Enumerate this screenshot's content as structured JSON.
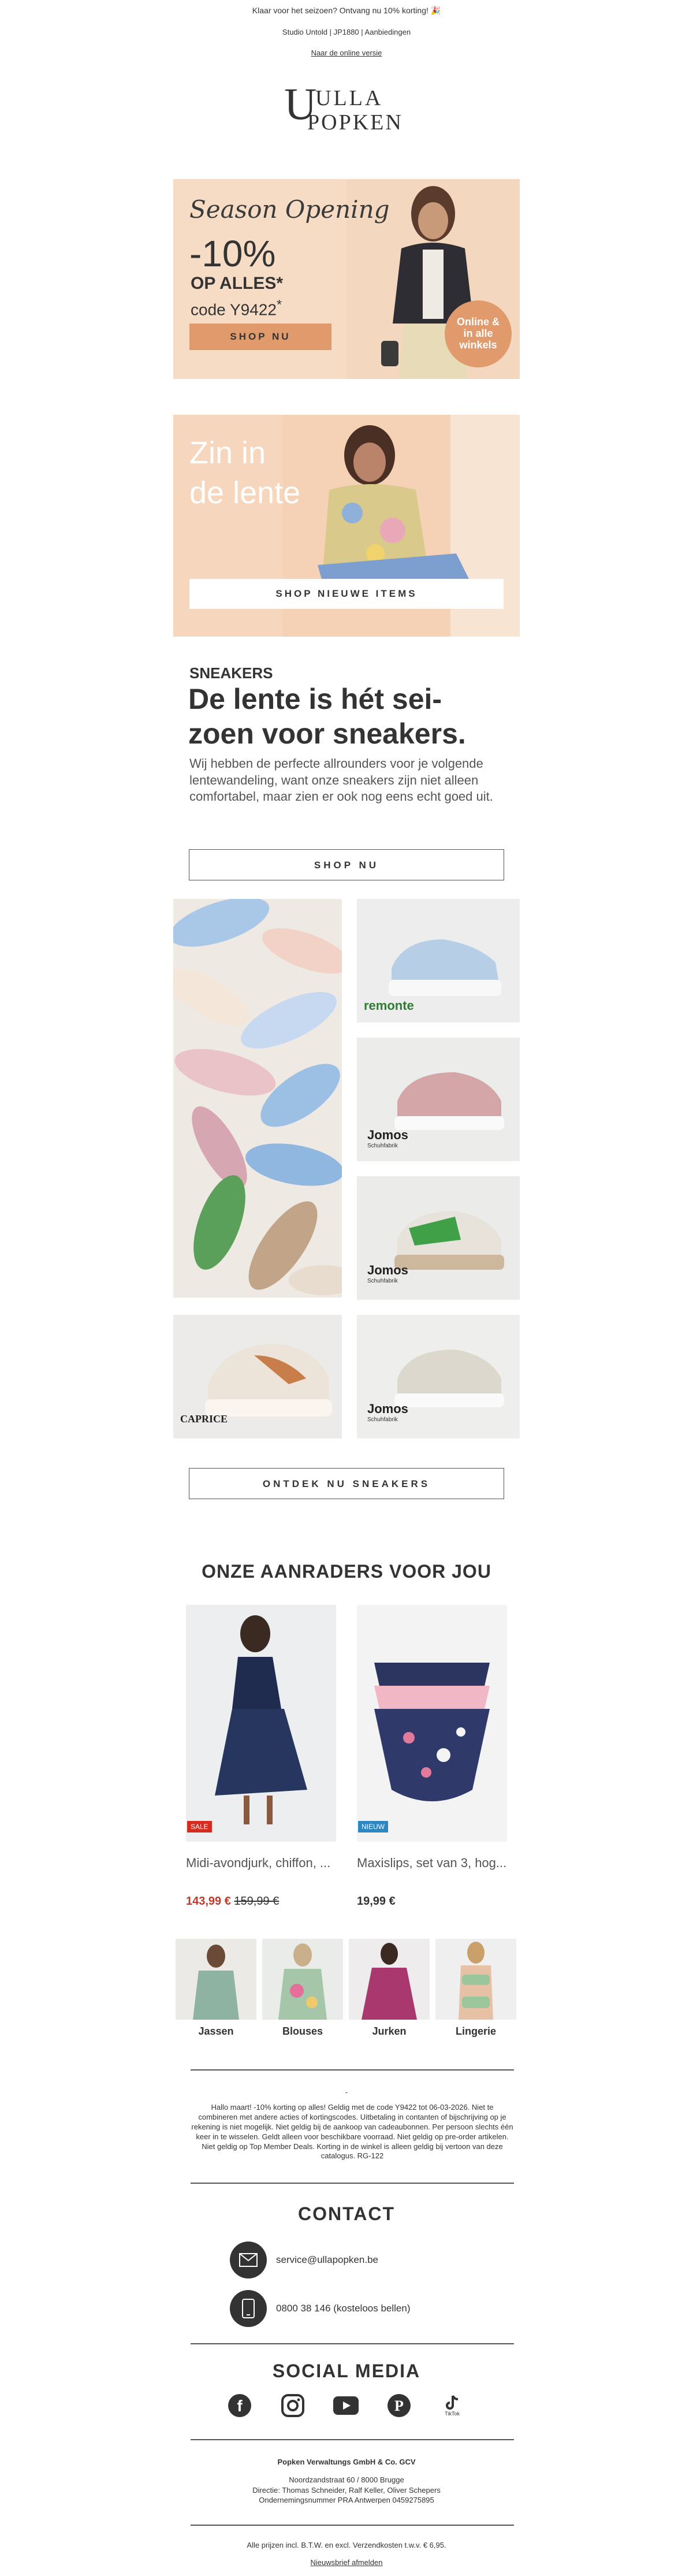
{
  "header": {
    "preheader": "Klaar voor het seizoen? Ontvang nu 10% korting! 🎉",
    "subnav": "Studio Untold | JP1880 | Aanbiedingen",
    "web_version": "Naar de online versie",
    "logo_top": "ULLA",
    "logo_bottom": "POPKEN"
  },
  "hero1": {
    "script": "Season Opening",
    "percent": "-10%",
    "op_alles": "OP ALLES*",
    "code": "code Y9422",
    "code_sup": "*",
    "button": "SHOP NU",
    "badge": "Online & in alle winkels",
    "colors": {
      "background": "#f6dcc4",
      "accent": "#e19a6b"
    }
  },
  "hero2": {
    "title_line1": "Zin in",
    "title_line2": "de lente",
    "button": "SHOP NIEUWE ITEMS"
  },
  "sneakers": {
    "kicker": "SNEAKERS",
    "headline_line1": "De lente is hét sei-",
    "headline_line2": "zoen voor sneakers.",
    "body": "Wij hebben de perfecte allrounders voor je volgende lentewandeling, want onze sneakers zijn niet alleen comfortabel, maar zien er ook nog eens echt goed uit.",
    "button": "SHOP NU",
    "brands": {
      "remonte": "remonte",
      "jomos": "Jomos",
      "jomos_sub": "Schuhfabrik",
      "caprice": "CAPRICE"
    },
    "discover_button": "ONTDEK NU SNEAKERS"
  },
  "recommendations": {
    "title": "ONZE AANRADERS VOOR JOU",
    "products": [
      {
        "name": "Midi-avondjurk, chiffon, ...",
        "price": "143,99 €",
        "old_price": "159,99 €",
        "tag": "SALE",
        "tag_color": "#d62b1f"
      },
      {
        "name": "Maxislips, set van 3, hog...",
        "price": "19,99 €",
        "old_price": "",
        "tag": "NIEUW",
        "tag_color": "#2e86c1"
      }
    ]
  },
  "categories": [
    {
      "label": "Jassen"
    },
    {
      "label": "Blouses"
    },
    {
      "label": "Jurken"
    },
    {
      "label": "Lingerie"
    }
  ],
  "disclaimer": {
    "dash": "-",
    "text": "Hallo maart! -10% korting op alles!  Geldig met de code Y9422 tot 06-03-2026. Niet te combineren met andere acties of kortingscodes. Uitbetaling in contanten of bijschrijving op je rekening is niet mogelijk. Niet geldig bij de aankoop van cadeaubonnen. Per persoon slechts één keer in te wisselen. Geldt alleen voor beschikbare voorraad. Niet geldig op pre-order artikelen. Niet geldig op Top Member Deals. Korting in de winkel is alleen geldig bij vertoon van deze catalogus. RG-122"
  },
  "contact": {
    "title": "CONTACT",
    "email": "service@ullapopken.be",
    "phone": "0800 38 146 (kosteloos bellen)"
  },
  "social": {
    "title": "SOCIAL MEDIA",
    "items": [
      "facebook-icon",
      "instagram-icon",
      "youtube-icon",
      "pinterest-icon",
      "tiktok-icon"
    ],
    "tiktok_label": "TikTok"
  },
  "footer": {
    "company": "Popken Verwaltungs GmbH & Co. GCV",
    "address": "Noordzandstraat 60 / 8000 Brugge",
    "directie": "Directie: Thomas Schneider, Ralf Keller, Oliver Schepers",
    "register": "Ondernemingsnummer PRA Antwerpen 0459275895",
    "prices": "Alle prijzen incl. B.T.W. en excl. Verzendkosten t.w.v. € 6,95.",
    "unsubscribe": "Nieuwsbrief afmelden"
  }
}
